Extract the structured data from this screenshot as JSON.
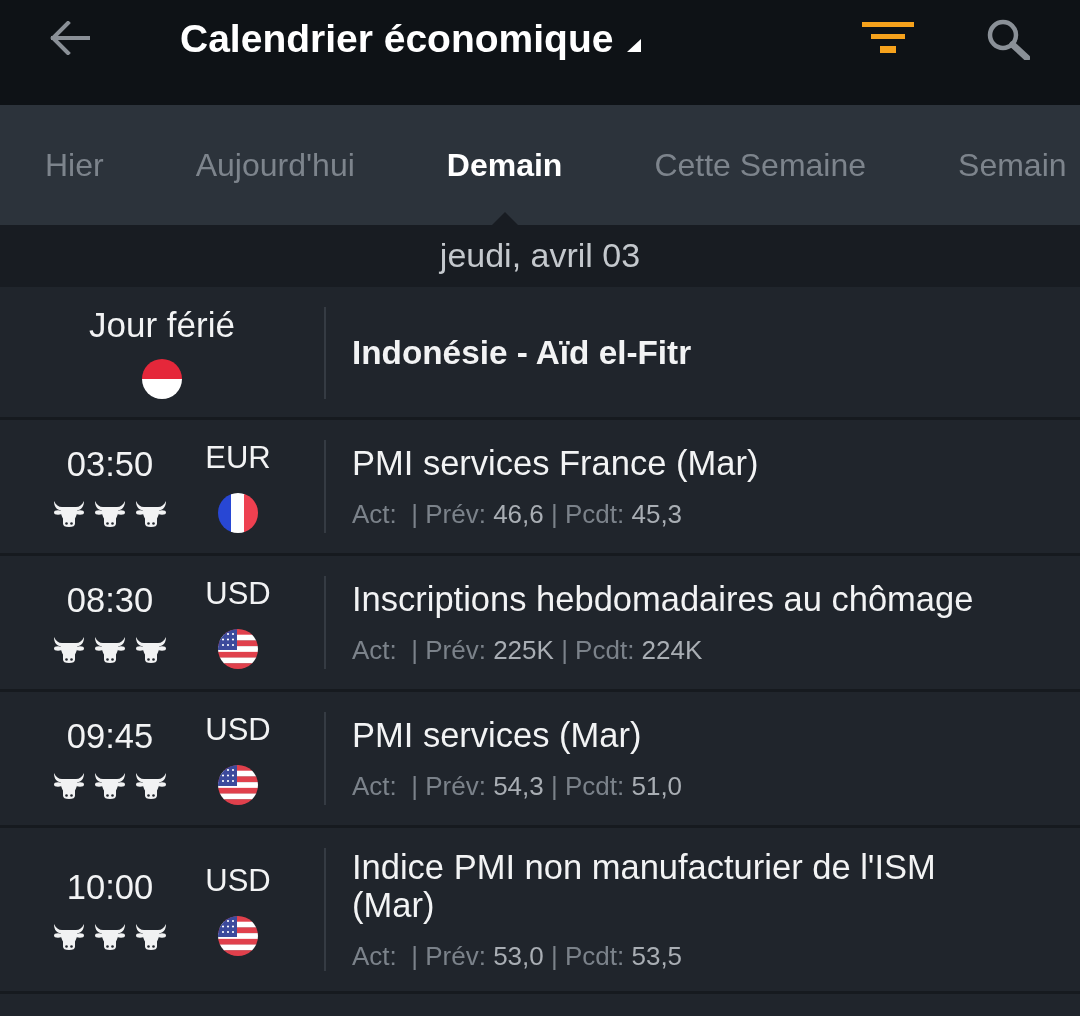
{
  "header": {
    "title": "Calendrier économique"
  },
  "tabs": [
    {
      "label": "Hier",
      "selected": false
    },
    {
      "label": "Aujourd'hui",
      "selected": false
    },
    {
      "label": "Demain",
      "selected": true
    },
    {
      "label": "Cette Semaine",
      "selected": false
    },
    {
      "label": "Semain",
      "selected": false
    }
  ],
  "date": "jeudi, avril 03",
  "events": [
    {
      "kind": "holiday",
      "label": "Jour férié",
      "flag": {
        "kind": "indonesia"
      },
      "title": "Indonésie - Aïd el-Fitr"
    },
    {
      "kind": "event",
      "time": "03:50",
      "currency": "EUR",
      "stars": 3,
      "flag": {
        "kind": "france"
      },
      "title": "PMI services France (Mar)",
      "details": [
        {
          "label": "Act:"
        },
        {
          "label": "| Prév:",
          "value": "46,6"
        },
        {
          "label": "| Pcdt:",
          "value": "45,3"
        }
      ]
    },
    {
      "kind": "event",
      "time": "08:30",
      "currency": "USD",
      "stars": 3,
      "flag": {
        "kind": "usa"
      },
      "title": "Inscriptions hebdomadaires au chômage",
      "details": [
        {
          "label": "Act:"
        },
        {
          "label": "| Prév:",
          "value": "225K"
        },
        {
          "label": "| Pcdt:",
          "value": "224K"
        }
      ]
    },
    {
      "kind": "event",
      "time": "09:45",
      "currency": "USD",
      "stars": 3,
      "flag": {
        "kind": "usa"
      },
      "title": "PMI services (Mar)",
      "details": [
        {
          "label": "Act:"
        },
        {
          "label": "| Prév:",
          "value": "54,3"
        },
        {
          "label": "| Pcdt:",
          "value": "51,0"
        }
      ]
    },
    {
      "kind": "event",
      "time": "10:00",
      "currency": "USD",
      "stars": 3,
      "flag": {
        "kind": "usa"
      },
      "title": "Indice PMI non manufacturier de l'ISM (Mar)",
      "details": [
        {
          "label": "Act:"
        },
        {
          "label": "| Prév:",
          "value": "53,0"
        },
        {
          "label": "| Pcdt:",
          "value": "53,5"
        }
      ]
    }
  ]
}
